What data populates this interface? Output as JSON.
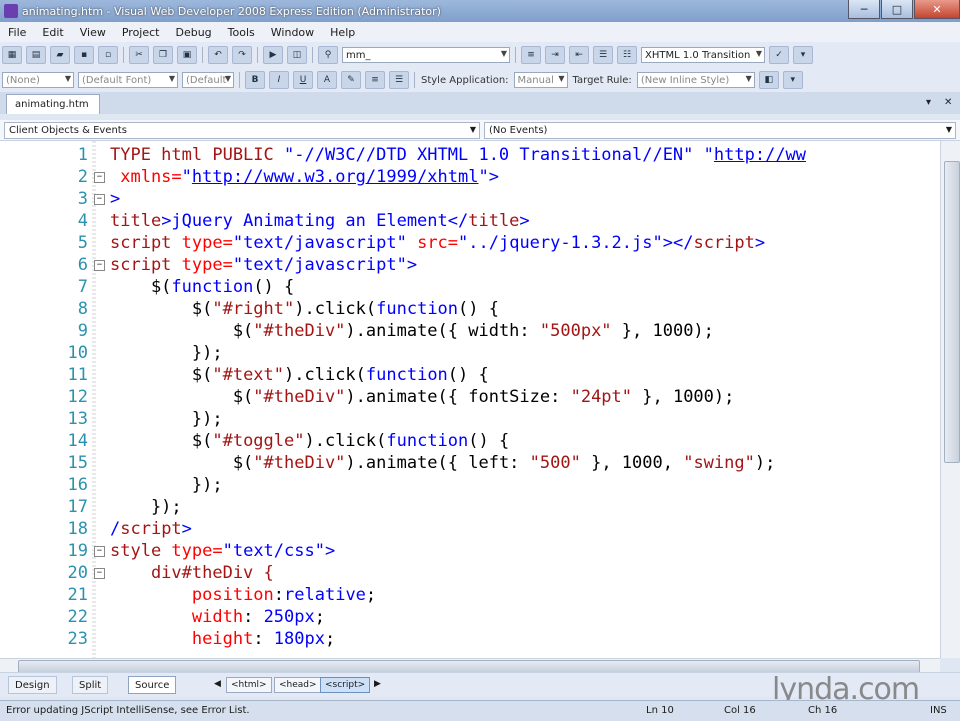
{
  "window": {
    "title": "animating.htm - Visual Web Developer 2008 Express Edition (Administrator)",
    "controls": [
      "─",
      "□",
      "✕"
    ]
  },
  "menu": [
    "File",
    "Edit",
    "View",
    "Project",
    "Debug",
    "Tools",
    "Window",
    "Help"
  ],
  "toolbar1": {
    "find_value": "mm_",
    "doctype_value": "XHTML 1.0 Transition"
  },
  "toolbar2": {
    "style_value": "(None)",
    "font_value": "(Default Font)",
    "size_value": "(Default",
    "bold": "B",
    "italic": "I",
    "underline": "U",
    "style_application_label": "Style Application:",
    "style_application_value": "Manual",
    "target_rule_label": "Target Rule:",
    "target_rule_value": "(New Inline Style)"
  },
  "tabs": {
    "active": "animating.htm",
    "pin": "▾",
    "close": "✕"
  },
  "object_bar": {
    "left": "Client Objects & Events",
    "right": "(No Events)"
  },
  "code_lines": [
    {
      "n": "1",
      "fold": ""
    },
    {
      "n": "2",
      "fold": "−"
    },
    {
      "n": "3",
      "fold": "−"
    },
    {
      "n": "4",
      "fold": ""
    },
    {
      "n": "5",
      "fold": ""
    },
    {
      "n": "6",
      "fold": "−"
    },
    {
      "n": "7",
      "fold": ""
    },
    {
      "n": "8",
      "fold": ""
    },
    {
      "n": "9",
      "fold": ""
    },
    {
      "n": "10",
      "fold": ""
    },
    {
      "n": "11",
      "fold": ""
    },
    {
      "n": "12",
      "fold": ""
    },
    {
      "n": "13",
      "fold": ""
    },
    {
      "n": "14",
      "fold": ""
    },
    {
      "n": "15",
      "fold": ""
    },
    {
      "n": "16",
      "fold": ""
    },
    {
      "n": "17",
      "fold": ""
    },
    {
      "n": "18",
      "fold": ""
    },
    {
      "n": "19",
      "fold": "−"
    },
    {
      "n": "20",
      "fold": "−"
    },
    {
      "n": "21",
      "fold": ""
    },
    {
      "n": "22",
      "fold": ""
    },
    {
      "n": "23",
      "fold": ""
    }
  ],
  "code": {
    "l1": {
      "a": "TYPE html PUBLIC ",
      "b": "\"-//W3C//DTD XHTML 1.0 Transitional//EN\"",
      "c": " ",
      "d": "\"",
      "e": "http://ww"
    },
    "l2": {
      "a": " xmlns=",
      "b": "\"",
      "c": "http://www.w3.org/1999/xhtml",
      "d": "\"",
      "e": ">"
    },
    "l3": {
      "a": ">"
    },
    "l4": {
      "a": "title",
      "b": ">jQuery Animating an Element</",
      "c": "title",
      "d": ">"
    },
    "l5": {
      "a": "script ",
      "b": "type=",
      "c": "\"text/javascript\"",
      "d": " src=",
      "e": "\"../jquery-1.3.2.js\"",
      "f": "></",
      "g": "script",
      "h": ">"
    },
    "l6": {
      "a": "script ",
      "b": "type=",
      "c": "\"text/javascript\"",
      "d": ">"
    },
    "l7": {
      "a": "    $(",
      "b": "function",
      "c": "() {"
    },
    "l8": {
      "a": "        $(",
      "b": "\"#right\"",
      "c": ").click(",
      "d": "function",
      "e": "() {"
    },
    "l9": {
      "a": "            $(",
      "b": "\"#theDiv\"",
      "c": ").animate({ width: ",
      "d": "\"500px\"",
      "e": " }, 1000);"
    },
    "l10": {
      "a": "        });"
    },
    "l11": {
      "a": "        $(",
      "b": "\"#text\"",
      "c": ").click(",
      "d": "function",
      "e": "() {"
    },
    "l12": {
      "a": "            $(",
      "b": "\"#theDiv\"",
      "c": ").animate({ fontSize: ",
      "d": "\"24pt\"",
      "e": " }, 1000);"
    },
    "l13": {
      "a": "        });"
    },
    "l14": {
      "a": "        $(",
      "b": "\"#toggle\"",
      "c": ").click(",
      "d": "function",
      "e": "() {"
    },
    "l15": {
      "a": "            $(",
      "b": "\"#theDiv\"",
      "c": ").animate({ left: ",
      "d": "\"500\"",
      "e": " }, 1000, ",
      "f": "\"swing\"",
      "g": ");"
    },
    "l16": {
      "a": "        });"
    },
    "l17": {
      "a": "    });"
    },
    "l18": {
      "a": "/",
      "b": "script",
      "c": ">"
    },
    "l19": {
      "a": "style ",
      "b": "type=",
      "c": "\"text/css\"",
      "d": ">"
    },
    "l20": {
      "a": "    div#theDiv {"
    },
    "l21": {
      "a": "        ",
      "b": "position",
      "c": ":",
      "d": "relative",
      "e": ";"
    },
    "l22": {
      "a": "        ",
      "b": "width",
      "c": ": ",
      "d": "250px",
      "e": ";"
    },
    "l23": {
      "a": "        ",
      "b": "height",
      "c": ": ",
      "d": "180px",
      "e": ";"
    }
  },
  "views": {
    "design": "Design",
    "split": "Split",
    "source": "Source"
  },
  "breadcrumbs": [
    "<html>",
    "<head>",
    "<script>"
  ],
  "watermark": "lynda.com",
  "status": {
    "message": "Error updating JScript IntelliSense, see Error List.",
    "ln": "Ln 10",
    "col": "Col 16",
    "ch": "Ch 16",
    "mode": "INS"
  }
}
